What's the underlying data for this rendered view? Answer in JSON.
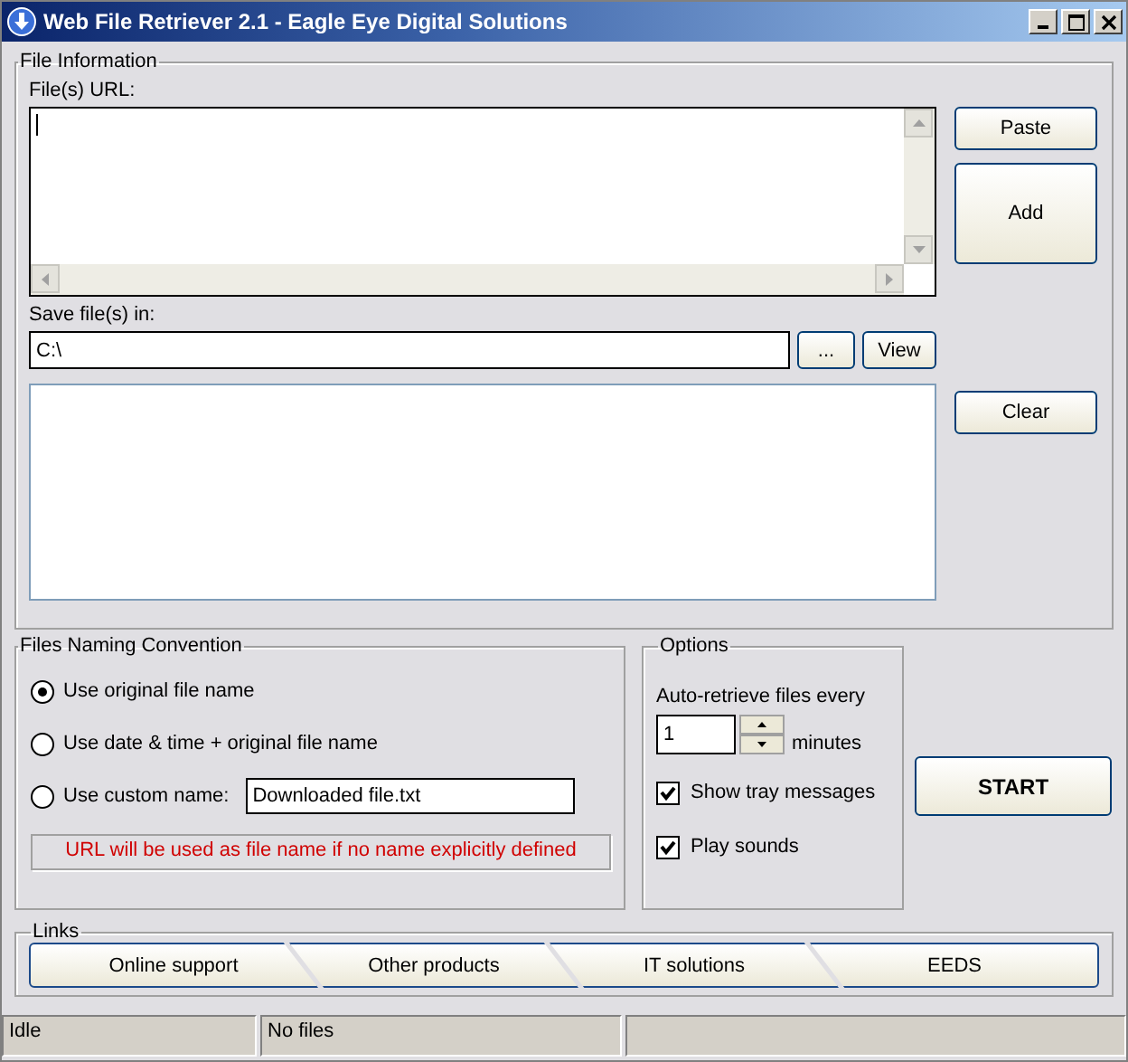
{
  "window": {
    "title": "Web File Retriever 2.1 - Eagle Eye Digital Solutions"
  },
  "file_information": {
    "title": "File Information",
    "url_label": "File(s) URL:",
    "save_label": "Save file(s) in:",
    "save_path": "C:\\",
    "browse_button": "...",
    "view_button": "View",
    "paste_button": "Paste",
    "add_button": "Add",
    "clear_button": "Clear"
  },
  "naming": {
    "title": "Files Naming Convention",
    "options": [
      {
        "label": "Use original file name",
        "selected": true
      },
      {
        "label": "Use date & time + original file name",
        "selected": false
      },
      {
        "label": "Use custom name:",
        "selected": false,
        "value": "Downloaded file.txt"
      }
    ],
    "note": "URL will be used as file name if no name explicitly defined"
  },
  "options": {
    "title": "Options",
    "auto_label": "Auto-retrieve files every",
    "interval": "1",
    "unit": "minutes",
    "checks": [
      {
        "label": "Show tray messages",
        "checked": true
      },
      {
        "label": "Play sounds",
        "checked": true
      }
    ]
  },
  "start_button": "START",
  "links": {
    "title": "Links",
    "items": [
      "Online support",
      "Other products",
      "IT solutions",
      "EEDS"
    ]
  },
  "status_bar": [
    "Idle",
    "No files"
  ]
}
